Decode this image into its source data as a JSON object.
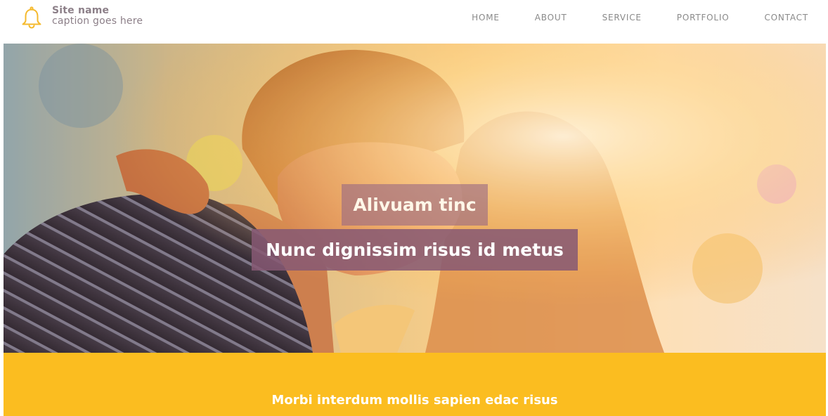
{
  "brand": {
    "icon": "bell-icon",
    "site_name": "Site name",
    "caption": "caption goes here",
    "accent_color": "#f5b92c"
  },
  "nav": {
    "items": [
      "HOME",
      "ABOUT",
      "SERVICE",
      "PORTFOLIO",
      "CONTACT"
    ]
  },
  "hero": {
    "title": "Alivuam tinc",
    "subtitle": "Nunc dignissim risus id metus",
    "title_bg": "#9a6982",
    "subtitle_bg": "#865873"
  },
  "band": {
    "text": "Morbi interdum mollis sapien edac risus",
    "color": "#fbbd20"
  }
}
